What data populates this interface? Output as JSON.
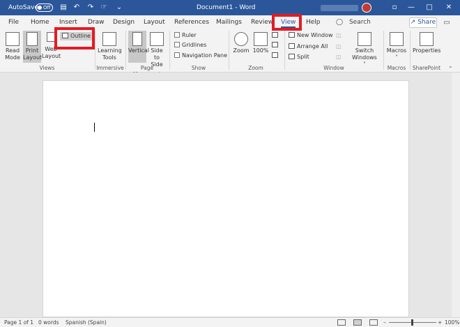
{
  "titlebar": {
    "autosave_label": "AutoSave",
    "autosave_state": "Off",
    "doc_title": "Document1 - Word",
    "qa_icons": [
      "save-icon",
      "undo-icon",
      "redo-icon",
      "touch-mode-icon",
      "customize-icon"
    ],
    "window_buttons": [
      "minimize-icon",
      "restore-icon",
      "close-icon"
    ]
  },
  "tabs": [
    "File",
    "Home",
    "Insert",
    "Draw",
    "Design",
    "Layout",
    "References",
    "Mailings",
    "Review",
    "View",
    "Help"
  ],
  "active_tab": "View",
  "search_label": "Search",
  "share_label": "Share",
  "ribbon": {
    "views": {
      "read_mode_1": "Read",
      "read_mode_2": "Mode",
      "print_layout_1": "Print",
      "print_layout_2": "Layout",
      "web_layout_1": "Web",
      "web_layout_2": "Layout",
      "outline": "Outline",
      "label": "Views"
    },
    "immersive": {
      "learning_tools_1": "Learning",
      "learning_tools_2": "Tools",
      "label": "Immersive"
    },
    "page_movement": {
      "vertical": "Vertical",
      "side_1": "Side",
      "side_2": "to Side",
      "label": "Page Movement"
    },
    "show": {
      "ruler": "Ruler",
      "gridlines": "Gridlines",
      "navigation_pane": "Navigation Pane",
      "label": "Show"
    },
    "zoom": {
      "zoom": "Zoom",
      "hundred": "100%",
      "label": "Zoom"
    },
    "window": {
      "new_window": "New Window",
      "arrange_all": "Arrange All",
      "split": "Split",
      "switch_1": "Switch",
      "switch_2": "Windows ˅",
      "label": "Window"
    },
    "macros": {
      "macros": "Macros",
      "macros_sub": "˅",
      "label": "Macros"
    },
    "sharepoint": {
      "properties": "Properties",
      "label": "SharePoint"
    }
  },
  "status": {
    "page": "Page 1 of 1",
    "words": "0 words",
    "language": "Spanish (Spain)",
    "zoom": "100%"
  },
  "colors": {
    "title_bar": "#2b579a",
    "highlight": "#e31b23"
  }
}
